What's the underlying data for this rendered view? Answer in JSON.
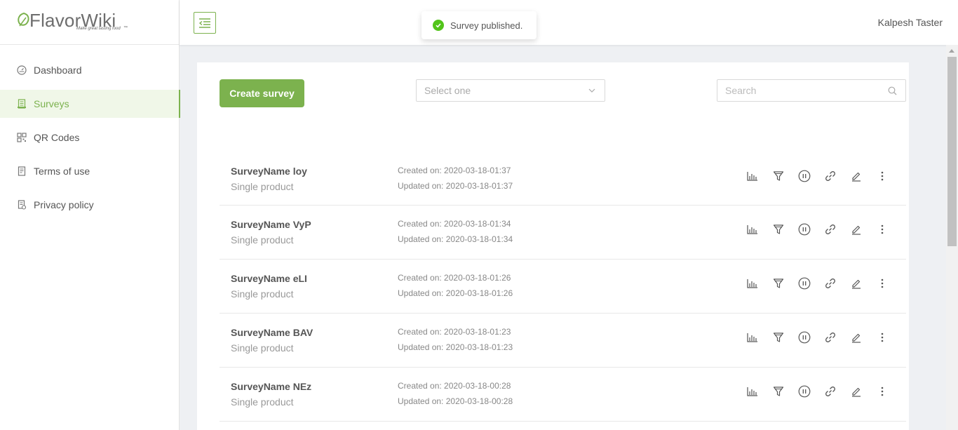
{
  "brand": {
    "name": "FlavorWiki",
    "tagline": "Make great tasting food",
    "accent": "#7cb24e"
  },
  "sidebar": {
    "items": [
      {
        "label": "Dashboard",
        "icon": "dashboard-gauge-icon",
        "active": false
      },
      {
        "label": "Surveys",
        "icon": "survey-document-icon",
        "active": true
      },
      {
        "label": "QR Codes",
        "icon": "qr-code-icon",
        "active": false
      },
      {
        "label": "Terms of use",
        "icon": "terms-document-icon",
        "active": false
      },
      {
        "label": "Privacy policy",
        "icon": "privacy-document-icon",
        "active": false
      }
    ]
  },
  "header": {
    "user_name": "Kalpesh Taster",
    "menu_icon": "collapse-menu-icon"
  },
  "toast": {
    "message": "Survey published.",
    "status_color": "#52c41a"
  },
  "toolbar": {
    "create_label": "Create survey",
    "select_placeholder": "Select one",
    "search_placeholder": "Search"
  },
  "surveys": [
    {
      "name": "SurveyName loy",
      "type": "Single product",
      "created": "Created on: 2020-03-18-01:37",
      "updated": "Updated on: 2020-03-18-01:37"
    },
    {
      "name": "SurveyName VyP",
      "type": "Single product",
      "created": "Created on: 2020-03-18-01:34",
      "updated": "Updated on: 2020-03-18-01:34"
    },
    {
      "name": "SurveyName eLI",
      "type": "Single product",
      "created": "Created on: 2020-03-18-01:26",
      "updated": "Updated on: 2020-03-18-01:26"
    },
    {
      "name": "SurveyName BAV",
      "type": "Single product",
      "created": "Created on: 2020-03-18-01:23",
      "updated": "Updated on: 2020-03-18-01:23"
    },
    {
      "name": "SurveyName NEz",
      "type": "Single product",
      "created": "Created on: 2020-03-18-00:28",
      "updated": "Updated on: 2020-03-18-00:28"
    }
  ],
  "row_actions": [
    "stats-chart-icon",
    "funnel-filter-icon",
    "pause-circle-icon",
    "link-icon",
    "edit-pencil-icon",
    "more-vertical-icon"
  ]
}
